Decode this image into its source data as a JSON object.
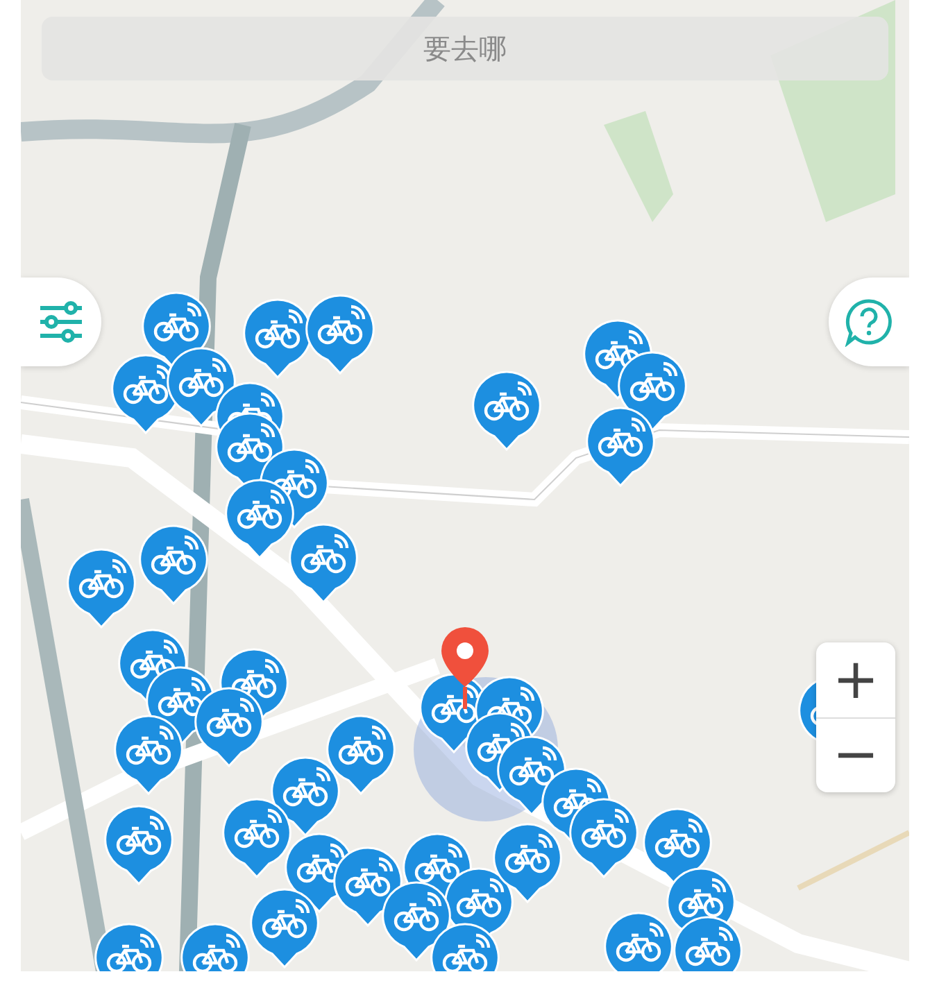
{
  "search": {
    "placeholder": "要去哪"
  },
  "zoom_controls": [
    {
      "label": "+"
    },
    {
      "label": "−"
    }
  ]
}
